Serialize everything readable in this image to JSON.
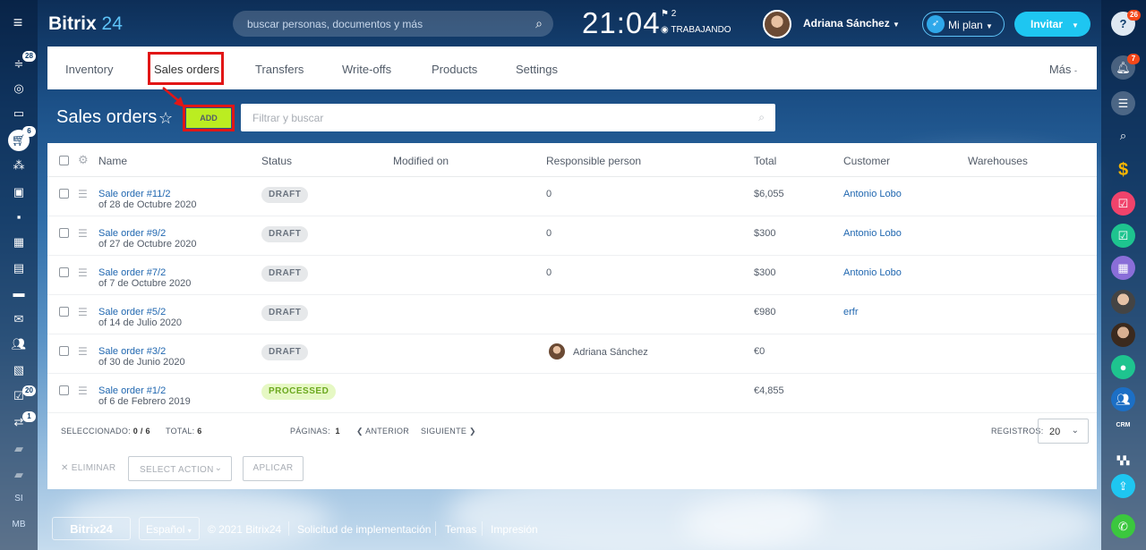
{
  "header": {
    "logo_name": "Bitrix",
    "logo_num": "24",
    "search_placeholder": "buscar personas, documentos y más",
    "clock": "21:04",
    "clock_flag": "2",
    "clock_state": "TRABAJANDO",
    "user_name": "Adriana Sánchez",
    "plan_label": "Mi plan",
    "invite_label": "Invitar"
  },
  "left_sidebar": {
    "badges": {
      "feed": "28",
      "cart": "6",
      "tasks": "20",
      "sync": "1"
    },
    "text_items": [
      "SI",
      "MB"
    ]
  },
  "right_sidebar": {
    "badges": {
      "help": "26",
      "notifications": "7"
    },
    "crm_label": "CRM"
  },
  "tabs": [
    "Inventory",
    "Sales orders",
    "Transfers",
    "Write-offs",
    "Products",
    "Settings"
  ],
  "more_label": "Más",
  "page": {
    "title": "Sales orders",
    "add_label": "ADD",
    "filter_placeholder": "Filtrar y buscar"
  },
  "grid": {
    "columns": [
      "Name",
      "Status",
      "Modified on",
      "Responsible person",
      "Total",
      "Customer",
      "Warehouses"
    ],
    "rows": [
      {
        "name": "Sale order #11/2",
        "date": "of 28 de Octubre 2020",
        "status": "DRAFT",
        "responsible": "0",
        "total": "$6,055",
        "customer": "Antonio Lobo"
      },
      {
        "name": "Sale order #9/2",
        "date": "of 27 de Octubre 2020",
        "status": "DRAFT",
        "responsible": "0",
        "total": "$300",
        "customer": "Antonio Lobo"
      },
      {
        "name": "Sale order #7/2",
        "date": "of 7 de Octubre 2020",
        "status": "DRAFT",
        "responsible": "0",
        "total": "$300",
        "customer": "Antonio Lobo"
      },
      {
        "name": "Sale order #5/2",
        "date": "of 14 de Julio 2020",
        "status": "DRAFT",
        "responsible": "",
        "total": "€980",
        "customer": "erfr"
      },
      {
        "name": "Sale order #3/2",
        "date": "of 30 de Junio 2020",
        "status": "DRAFT",
        "responsible": "Adriana Sánchez",
        "total": "€0",
        "customer": ""
      },
      {
        "name": "Sale order #1/2",
        "date": "of 6 de Febrero 2019",
        "status": "PROCESSED",
        "responsible": "",
        "total": "€4,855",
        "customer": ""
      }
    ],
    "footer": {
      "selected_label": "SELECCIONADO:",
      "selected_value": "0 / 6",
      "total_label": "TOTAL:",
      "total_value": "6",
      "pages_label": "PÁGINAS:",
      "pages_value": "1",
      "prev_label": "ANTERIOR",
      "next_label": "SIGUIENTE",
      "records_label": "REGISTROS:",
      "records_value": "20"
    }
  },
  "actions": {
    "delete_label": "ELIMINAR",
    "select_action_label": "SELECT ACTION",
    "apply_label": "APLICAR"
  },
  "footer": {
    "logo": "Bitrix24",
    "language": "Español",
    "copyright": "© 2021 Bitrix24",
    "link_implementation": "Solicitud de implementación",
    "link_themes": "Temas",
    "link_print": "Impresión"
  },
  "colors": {
    "accent_blue": "#2067b0",
    "add_green": "#bbed21",
    "invite_cyan": "#1ec6f1",
    "highlight_red": "#e11616",
    "badge_red": "#f54819"
  }
}
